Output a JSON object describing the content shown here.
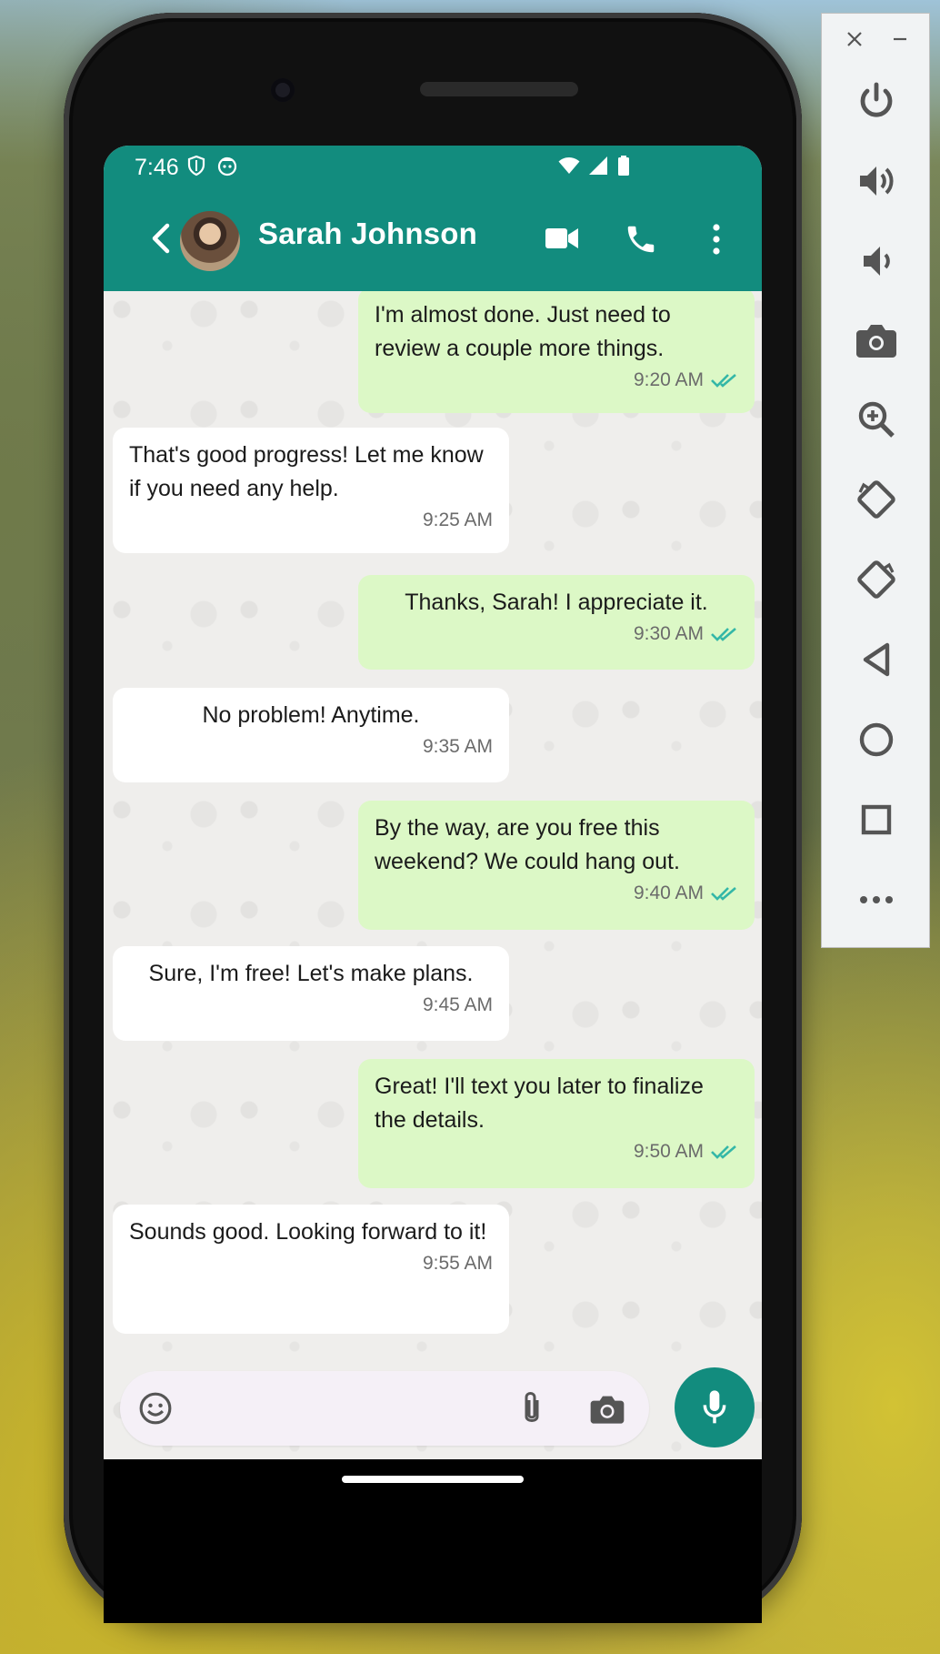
{
  "status_bar": {
    "time": "7:46"
  },
  "header": {
    "contact_name": "Sarah Johnson"
  },
  "messages": [
    {
      "direction": "out",
      "text": "I'm almost done. Just need to review a couple more things.",
      "time": "9:20 AM"
    },
    {
      "direction": "in",
      "text": "That's good progress! Let me know if you need any help.",
      "time": "9:25 AM"
    },
    {
      "direction": "out",
      "text": "Thanks, Sarah! I appreciate it.",
      "time": "9:30 AM"
    },
    {
      "direction": "in",
      "text": "No problem! Anytime.",
      "time": "9:35 AM"
    },
    {
      "direction": "out",
      "text": "By the way, are you free this weekend? We could hang out.",
      "time": "9:40 AM"
    },
    {
      "direction": "in",
      "text": "Sure, I'm free! Let's make plans.",
      "time": "9:45 AM"
    },
    {
      "direction": "out",
      "text": "Great! I'll text you later to finalize the details.",
      "time": "9:50 AM"
    },
    {
      "direction": "in",
      "text": "Sounds good. Looking forward to it!",
      "time": "9:55 AM"
    }
  ],
  "composer": {
    "message_value": ""
  },
  "colors": {
    "brand": "#128c7e",
    "outgoing_bubble": "#dcf8c6",
    "incoming_bubble": "#ffffff",
    "read_ticks": "#34b7a7"
  },
  "emulator_panel": {
    "icons": [
      "close-icon",
      "minimize-icon",
      "power-icon",
      "volume-up-icon",
      "volume-down-icon",
      "camera-icon",
      "zoom-icon",
      "rotate-left-icon",
      "rotate-right-icon",
      "back-icon",
      "home-icon",
      "overview-icon",
      "more-icon"
    ]
  }
}
